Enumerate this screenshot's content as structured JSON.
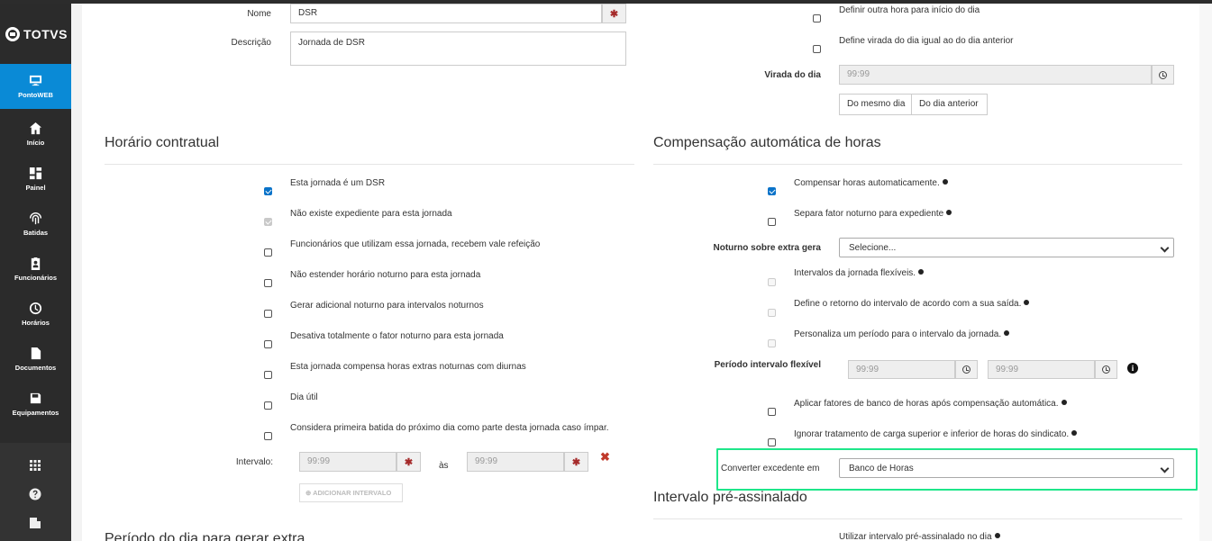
{
  "brand": {
    "logo_text": "TOTVS"
  },
  "sidebar": {
    "items": [
      {
        "label": "PontoWEB",
        "icon": "monitor-icon",
        "active": true
      },
      {
        "label": "Início",
        "icon": "home-icon"
      },
      {
        "label": "Painel",
        "icon": "dashboard-icon"
      },
      {
        "label": "Batidas",
        "icon": "fingerprint-icon"
      },
      {
        "label": "Funcionários",
        "icon": "badge-icon"
      },
      {
        "label": "Horários",
        "icon": "clock-icon"
      },
      {
        "label": "Documentos",
        "icon": "document-icon"
      },
      {
        "label": "Equipamentos",
        "icon": "save-icon"
      }
    ],
    "bottom_icons": [
      "apps-grid-icon",
      "help-icon",
      "building-icon"
    ]
  },
  "form": {
    "nome_label": "Nome",
    "nome_value": "DSR",
    "descricao_label": "Descrição",
    "descricao_value": "Jornada de DSR"
  },
  "top_right": {
    "cb1_label": "Definir outra hora para início do dia",
    "cb2_label": "Define virada do dia igual ao do dia anterior",
    "virada_label": "Virada do dia",
    "virada_value": "99:99",
    "btn_mesmo_dia": "Do mesmo dia",
    "btn_dia_anterior": "Do dia anterior"
  },
  "horario_contratual": {
    "title": "Horário contratual",
    "options": [
      {
        "label": "Esta jornada é um DSR",
        "checked": true,
        "disabled": false
      },
      {
        "label": "Não existe expediente para esta jornada",
        "checked": true,
        "disabled": true
      },
      {
        "label": "Funcionários que utilizam essa jornada, recebem vale refeição",
        "checked": false,
        "disabled": false
      },
      {
        "label": "Não estender horário noturno para esta jornada",
        "checked": false,
        "disabled": false
      },
      {
        "label": "Gerar adicional noturno para intervalos noturnos",
        "checked": false,
        "disabled": false
      },
      {
        "label": "Desativa totalmente o fator noturno para esta jornada",
        "checked": false,
        "disabled": false
      },
      {
        "label": "Esta jornada compensa horas extras noturnas com diurnas",
        "checked": false,
        "disabled": false
      },
      {
        "label": "Dia útil",
        "checked": false,
        "disabled": false
      },
      {
        "label": "Considera primeira batida do próximo dia como parte desta jornada caso ímpar.",
        "checked": false,
        "disabled": false
      }
    ],
    "intervalo_label": "Intervalo:",
    "intervalo_start": "99:99",
    "intervalo_sep": "às",
    "intervalo_end": "99:99",
    "add_intervalo": "ADICIONAR INTERVALO"
  },
  "compensacao": {
    "title": "Compensação automática de horas",
    "cb_compensar": "Compensar horas automaticamente.",
    "cb_separa": "Separa fator noturno para expediente",
    "noturno_label": "Noturno sobre extra gera",
    "noturno_value": "Selecione...",
    "cb_flexiveis": "Intervalos da jornada flexíveis.",
    "cb_retorno": "Define o retorno do intervalo de acordo com a sua saída.",
    "cb_personaliza": "Personaliza um período para o intervalo da jornada.",
    "periodo_label": "Período intervalo flexível",
    "periodo_start": "99:99",
    "periodo_end": "99:99",
    "cb_aplicar": "Aplicar fatores de banco de horas após compensação automática.",
    "cb_ignorar": "Ignorar tratamento de carga superior e inferior de horas do sindicato.",
    "converter_label": "Converter excedente em",
    "converter_value": "Banco de Horas"
  },
  "intervalo_pre": {
    "title": "Intervalo pré-assinalado",
    "cb_utilizar": "Utilizar intervalo pré-assinalado no dia"
  },
  "bottom_left_title": "Período do dia para gerar extra",
  "colors": {
    "accent": "#0a8ad6",
    "highlight": "#1ee68a",
    "sidebar": "#2b2b2b"
  }
}
